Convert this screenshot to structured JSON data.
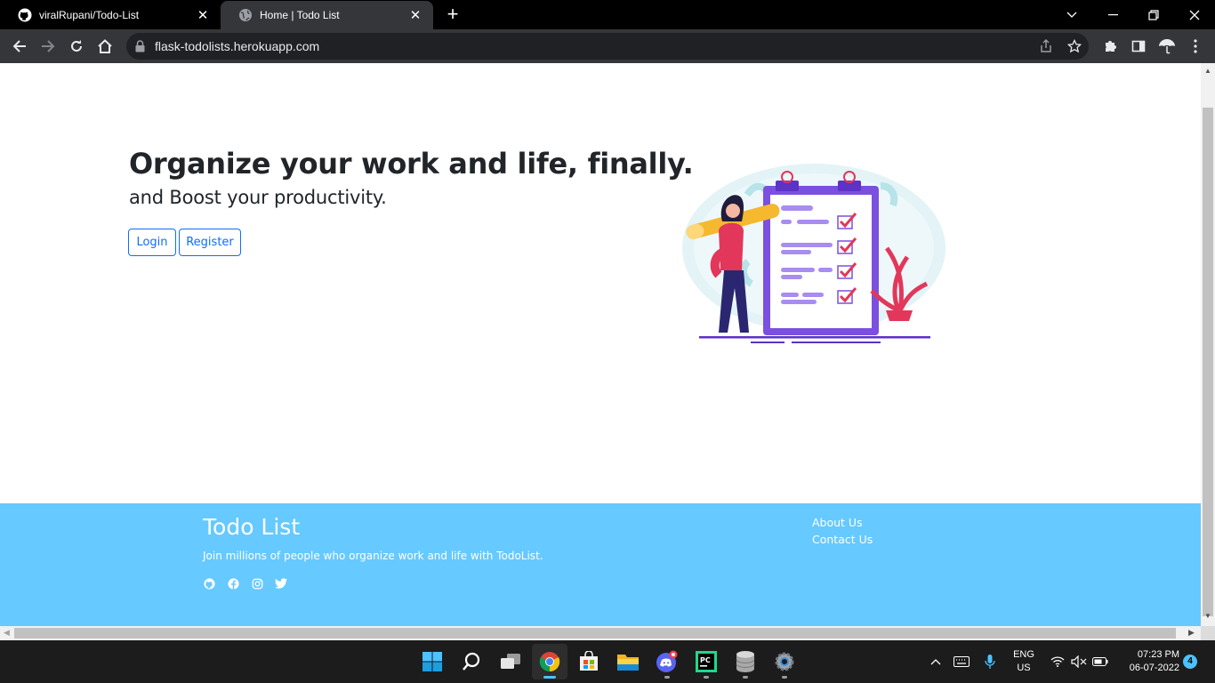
{
  "browser": {
    "tabs": [
      {
        "title": "viralRupani/Todo-List",
        "favicon": "github-icon"
      },
      {
        "title": "Home | Todo List",
        "favicon": "globe-icon",
        "active": true
      }
    ],
    "address_bar": {
      "host": "flask-todolists.herokuapp.com"
    }
  },
  "page": {
    "hero": {
      "title": "Organize your work and life, finally.",
      "subtitle": "and Boost your productivity.",
      "login_label": "Login",
      "register_label": "Register"
    },
    "footer": {
      "title": "Todo List",
      "description": "Join millions of people who organize work and life with TodoList.",
      "links": [
        "About Us",
        "Contact Us"
      ],
      "social_icons": [
        "github-icon",
        "facebook-icon",
        "instagram-icon",
        "twitter-icon"
      ],
      "background": "#66c9ff"
    },
    "accent_color": "#0d6efd"
  },
  "taskbar": {
    "apps": [
      "start-icon",
      "search-icon",
      "task-view-icon",
      "chrome-icon",
      "store-icon",
      "file-explorer-icon",
      "discord-icon",
      "pycharm-icon",
      "database-icon",
      "settings-icon"
    ],
    "language": {
      "line1": "ENG",
      "line2": "US"
    },
    "clock": {
      "time": "07:23 PM",
      "date": "06-07-2022"
    },
    "notification_count": "4"
  }
}
